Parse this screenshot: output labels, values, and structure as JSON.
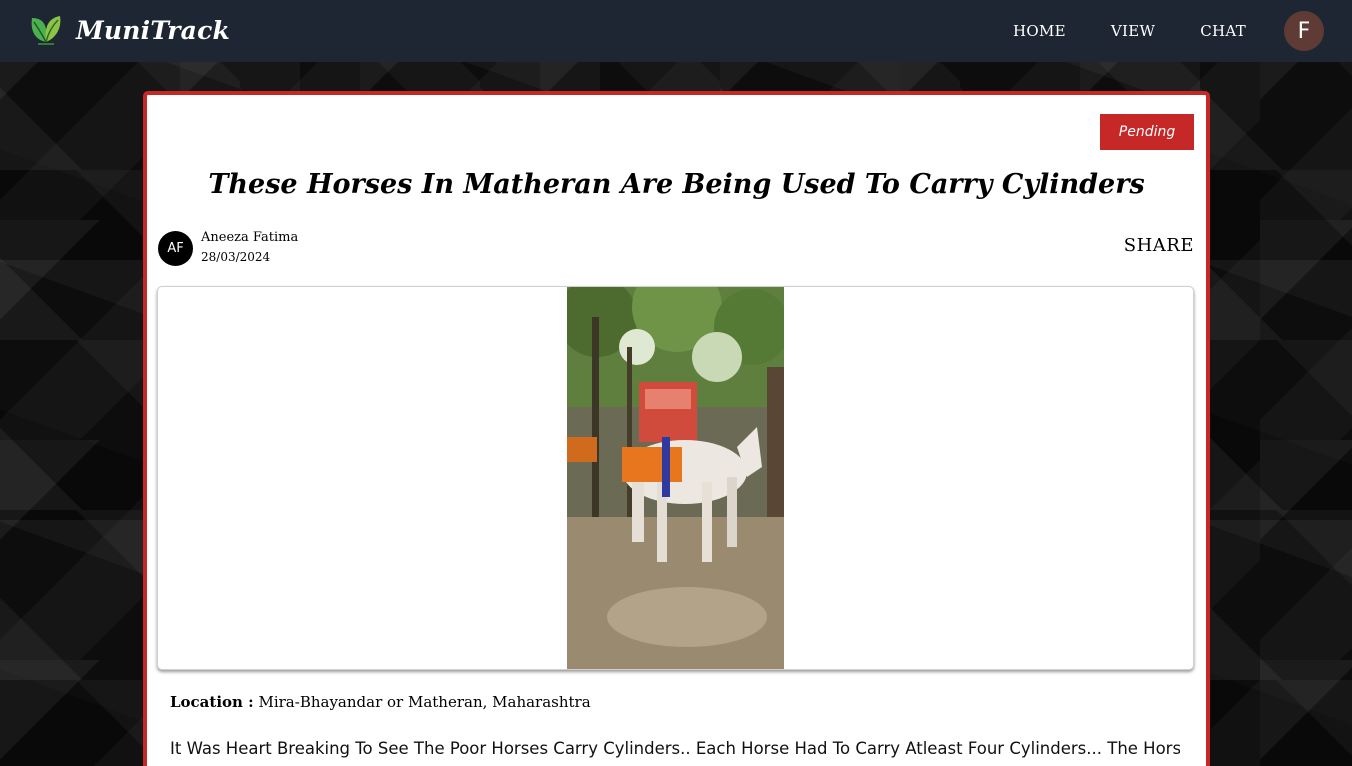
{
  "navbar": {
    "brand": "MuniTrack",
    "links": [
      "HOME",
      "VIEW",
      "CHAT"
    ],
    "profile_initial": "F"
  },
  "post": {
    "status": "Pending",
    "title": "These Horses In Matheran Are Being Used To Carry Cylinders",
    "author": {
      "initials": "AF",
      "name": "Aneeza Fatima",
      "date": "28/03/2024"
    },
    "share_label": "SHARE",
    "location_label": "Location :",
    "location": "Mira-Bhayandar or Matheran, Maharashtra",
    "description": "It Was Heart Breaking To See The Poor Horses Carry Cylinders.. Each Horse Had To Carry Atleast Four Cylinders... The Horses"
  },
  "colors": {
    "navbar_bg": "#1f2633",
    "accent_red": "#c62828",
    "profile_avatar": "#5e3c35"
  },
  "icons": {
    "logo": "leaf-logo-icon"
  }
}
